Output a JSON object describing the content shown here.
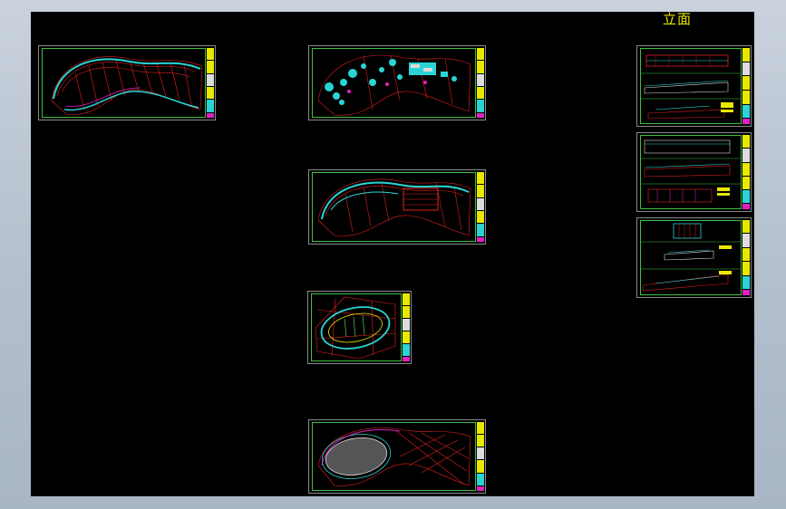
{
  "header": {
    "elevation_label": "立面"
  },
  "colors": {
    "background": "#000000",
    "frame": "#3fbf3f",
    "title_block": "#e8e800",
    "curve_red": "#e02020",
    "curve_cyan": "#2ad4d4",
    "accent_magenta": "#e020c0"
  },
  "sheets": [
    {
      "id": "plan-1",
      "kind": "plan"
    },
    {
      "id": "plan-2",
      "kind": "plan"
    },
    {
      "id": "plan-3",
      "kind": "plan"
    },
    {
      "id": "plan-4",
      "kind": "plan"
    },
    {
      "id": "plan-5",
      "kind": "plan"
    },
    {
      "id": "elevation-1",
      "kind": "elevation"
    },
    {
      "id": "elevation-2",
      "kind": "elevation"
    },
    {
      "id": "elevation-3",
      "kind": "elevation"
    }
  ]
}
